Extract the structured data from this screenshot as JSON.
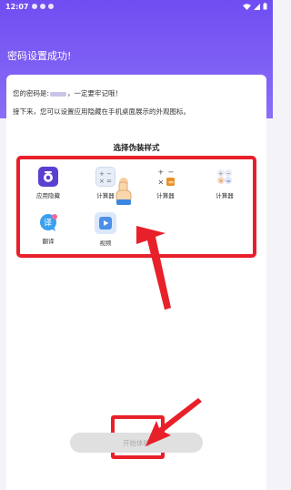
{
  "status_bar": {
    "time": "12:07"
  },
  "header": {
    "title": "密码设置成功!"
  },
  "message": {
    "prefix": "您的密码是:",
    "suffix": "，一定要牢记哦！",
    "line2": "接下来，您可以设置应用隐藏在手机桌面展示的外观图标。"
  },
  "disguise": {
    "title": "选择伪装样式",
    "items": [
      {
        "label": "应用隐藏",
        "icon": "purple-camera-icon"
      },
      {
        "label": "计算器",
        "icon": "calculator-icon-light"
      },
      {
        "label": "计算器",
        "icon": "calculator-icon"
      },
      {
        "label": "计算器",
        "icon": "calculator-dots-icon"
      },
      {
        "label": "翻译",
        "icon": "translate-icon"
      },
      {
        "label": "视频",
        "icon": "video-play-icon"
      }
    ]
  },
  "start_button": {
    "label": "开始体验"
  },
  "colors": {
    "accent": "#6f4df2",
    "annotation": "#e8202a"
  }
}
